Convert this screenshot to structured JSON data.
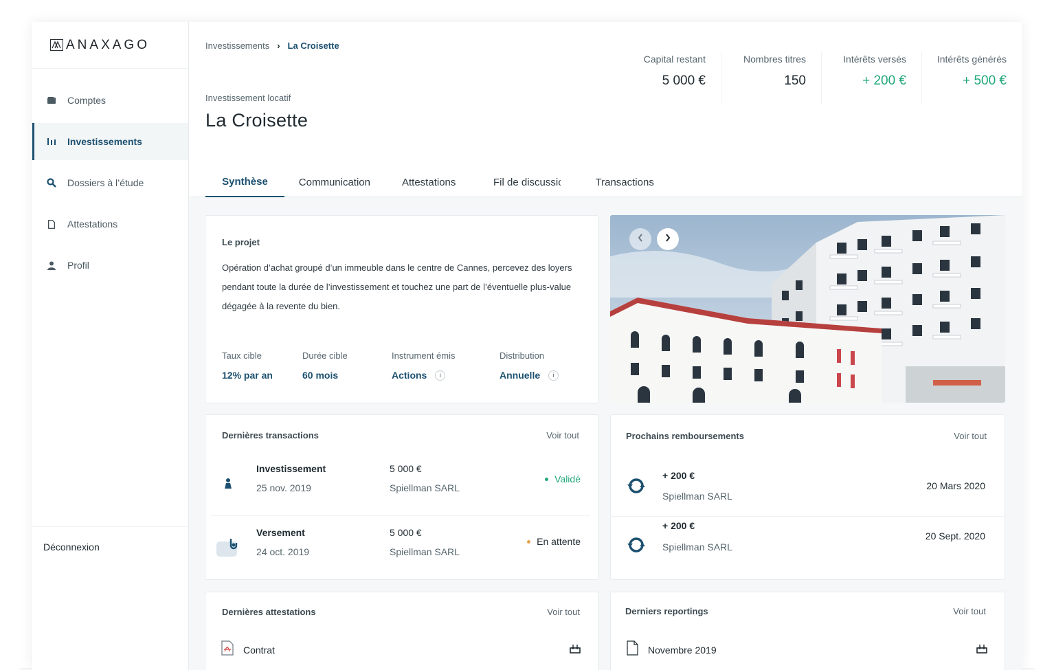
{
  "brand": {
    "name": "ANAXAGO"
  },
  "sidebar": {
    "items": [
      {
        "label": "Comptes",
        "icon": "wallet-icon",
        "active": false
      },
      {
        "label": "Investissements",
        "icon": "bar-chart-icon",
        "active": true
      },
      {
        "label": "Dossiers à l’étude",
        "icon": "search-icon",
        "active": false
      },
      {
        "label": "Attestations",
        "icon": "document-icon",
        "active": false
      },
      {
        "label": "Profil",
        "icon": "user-icon",
        "active": false
      }
    ],
    "logout": "Déconnexion"
  },
  "header": {
    "breadcrumb": {
      "root": "Investissements",
      "current": "La Croisette"
    },
    "subtitle": "Investissement locatif",
    "title": "La Croisette",
    "stats": [
      {
        "label": "Capital restant",
        "value": "5 000 €",
        "color": "#1f2a30"
      },
      {
        "label": "Nombres titres",
        "value": "150",
        "color": "#1f2a30"
      },
      {
        "label": "Intérêts versés",
        "value": "+ 200 €",
        "color": "#21a878"
      },
      {
        "label": "Intérêts générés",
        "value": "+ 500 €",
        "color": "#21a878"
      }
    ],
    "tabs": [
      {
        "label": "Synthèse",
        "active": true
      },
      {
        "label": "Communication",
        "active": false
      },
      {
        "label": "Attestations",
        "active": false
      },
      {
        "label": "Fil de discussion",
        "active": false
      },
      {
        "label": "Transactions",
        "active": false
      }
    ]
  },
  "project": {
    "title": "Le projet",
    "description": "Opération d’achat groupé d’un immeuble dans le centre de Cannes, percevez des loyers pendant toute la durée de l’investissement et touchez une part de l’éventuelle plus-value dégagée à la revente du bien.",
    "kpis": [
      {
        "label": "Taux cible",
        "value": "12% par an",
        "info": false
      },
      {
        "label": "Durée cible",
        "value": "60 mois",
        "info": false
      },
      {
        "label": "Instrument émis",
        "value": "Actions",
        "info": true
      },
      {
        "label": "Distribution",
        "value": "Annuelle",
        "info": true
      }
    ],
    "info_glyph": "i"
  },
  "transactions": {
    "title": "Dernières transactions",
    "see_all": "Voir tout",
    "rows": [
      {
        "title": "Investissement",
        "date": "25 nov. 2019",
        "amount": "5 000 €",
        "counterparty": "Spiellman SARL",
        "status": "Validé",
        "status_color": "#21a878"
      },
      {
        "title": "Versement",
        "date": "24 oct. 2019",
        "amount": "5 000 €",
        "counterparty": "Spiellman SARL",
        "status": "En attente",
        "status_color": "#e8a24a"
      }
    ]
  },
  "repayments": {
    "title": "Prochains remboursements",
    "see_all": "Voir tout",
    "rows": [
      {
        "amount": "+ 200 €",
        "counterparty": "Spiellman SARL",
        "date": "20 Mars 2020"
      },
      {
        "amount": "+ 200 €",
        "counterparty": "Spiellman SARL",
        "date": "20 Sept. 2020"
      }
    ]
  },
  "attestations": {
    "title": "Dernières attestations",
    "see_all": "Voir tout",
    "items": [
      {
        "label": "Contrat",
        "icon": "pdf-icon"
      }
    ]
  },
  "reportings": {
    "title": "Derniers reportings",
    "see_all": "Voir tout",
    "items": [
      {
        "label": "Novembre 2019",
        "icon": "document-icon"
      }
    ]
  },
  "colors": {
    "primary": "#1c5070",
    "positive": "#21a878",
    "pending": "#e8a24a"
  }
}
